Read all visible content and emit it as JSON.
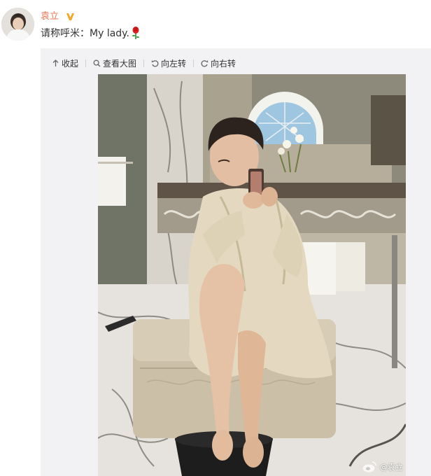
{
  "user": {
    "name": "袁立",
    "verified_icon": "verified-v-icon",
    "verified_color": "#f5a623",
    "name_color": "#eb7350"
  },
  "post": {
    "text": "请称呼米：My lady.",
    "emoji_icon": "rose-icon"
  },
  "toolbar": {
    "collapse_label": "收起",
    "view_large_label": "查看大图",
    "rotate_left_label": "向左转",
    "rotate_right_label": "向右转"
  },
  "photo": {
    "watermark": "@袁立"
  },
  "colors": {
    "panel_bg": "#f2f2f5",
    "text": "#333333"
  }
}
